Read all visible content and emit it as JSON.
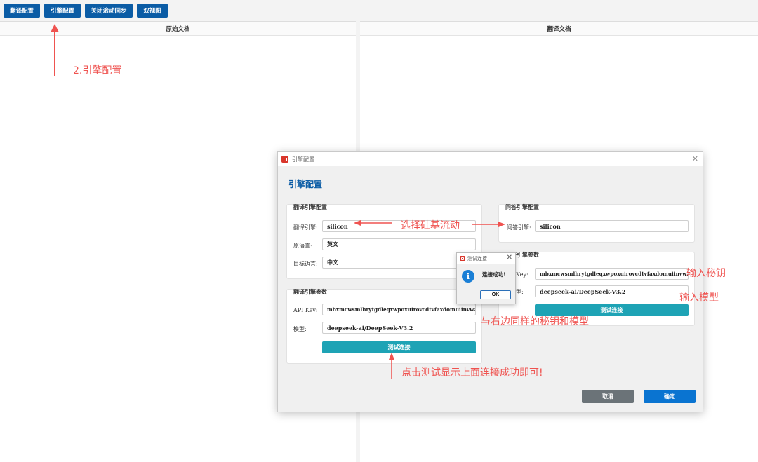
{
  "toolbar": {
    "buttons": [
      "翻译配置",
      "引擎配置",
      "关闭滚动同步",
      "双视图"
    ]
  },
  "panels": {
    "left_title": "原始文档",
    "right_title": "翻译文档"
  },
  "annotations": {
    "engine_config": "2.引擎配置",
    "choose_silicon": "选择硅基流动",
    "enter_key": "输入秘钥",
    "enter_model": "输入模型",
    "same_key_model": "与右边同样的秘钥和模型",
    "click_test": "点击测试显示上面连接成功即可!"
  },
  "dialog": {
    "window_title": "引擎配置",
    "heading": "引擎配置",
    "translate_group": {
      "title": "翻译引擎配置",
      "engine_label": "翻译引擎:",
      "engine_value": "silicon",
      "source_label": "原语言:",
      "source_value": "英文",
      "target_label": "目标语言:",
      "target_value": "中文"
    },
    "translate_params": {
      "title": "翻译引擎参数",
      "api_key_label": "API Key:",
      "api_key_value": "mbxmcwsmlhrytgdleqxwpoxuirovcdtvfaxdomuiinvwzh",
      "model_label": "模型:",
      "model_value": "deepseek-ai/DeepSeek-V3.2",
      "test_button": "测试连接"
    },
    "qa_group": {
      "title": "问答引擎配置",
      "engine_label": "问答引擎:",
      "engine_value": "silicon"
    },
    "qa_params": {
      "title": "问答引擎参数",
      "api_key_label": "Key:",
      "api_key_value": "mbxmcwsmlhrytgdleqxwpoxuirovcdtvfaxdomuiinvwzh",
      "model_label": "型:",
      "model_value": "deepseek-ai/DeepSeek-V3.2",
      "test_button": "测试连接"
    },
    "cancel_button": "取消",
    "ok_button": "确定"
  },
  "message_box": {
    "title": "测试连接",
    "text": "连接成功!",
    "ok_button": "OK"
  },
  "colors": {
    "primary": "#0b5ca5",
    "teal": "#1ea3b5",
    "annotation": "#ef5350",
    "cancel": "#6b7378",
    "ok": "#0a74d1"
  }
}
